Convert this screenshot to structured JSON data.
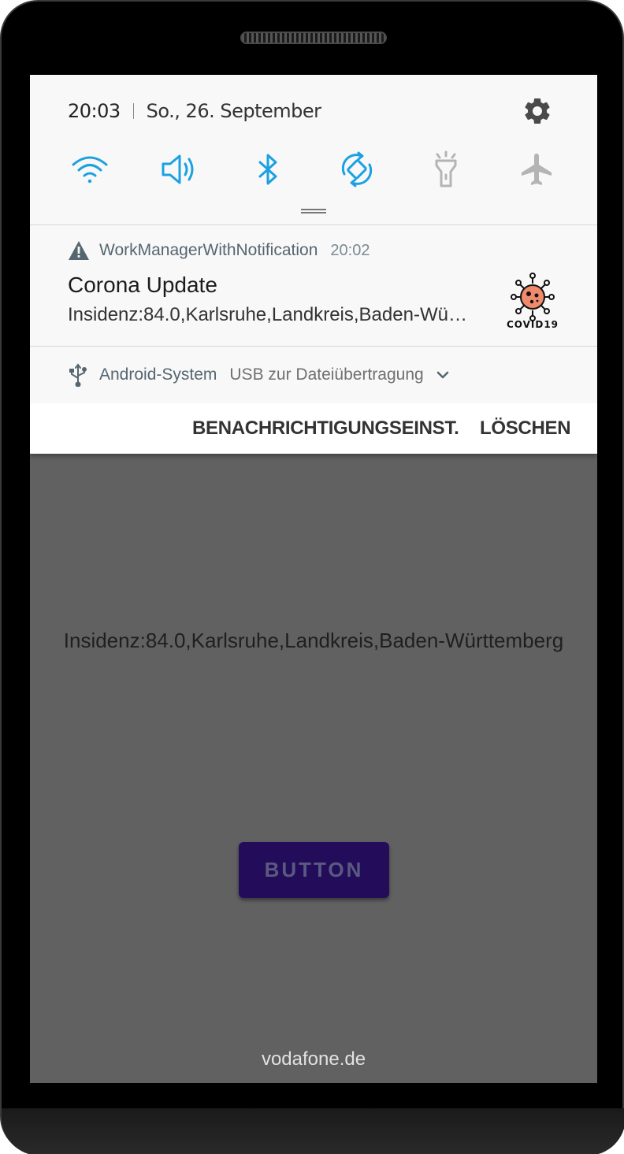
{
  "status": {
    "time": "20:03",
    "date": "So., 26. September"
  },
  "quick_settings": [
    {
      "icon": "wifi-icon",
      "active": true
    },
    {
      "icon": "sound-icon",
      "active": true
    },
    {
      "icon": "bluetooth-icon",
      "active": true
    },
    {
      "icon": "auto-rotate-icon",
      "active": true
    },
    {
      "icon": "flashlight-icon",
      "active": false
    },
    {
      "icon": "airplane-mode-icon",
      "active": false
    }
  ],
  "notification": {
    "app_name": "WorkManagerWithNotification",
    "time": "20:02",
    "title": "Corona Update",
    "text": "Insidenz:84.0,Karlsruhe,Landkreis,Baden-Württemberg",
    "icon_label": "COVID19"
  },
  "system_notification": {
    "app_name": "Android-System",
    "text": "USB zur Dateiübertragung"
  },
  "actions": {
    "settings_label": "BENACHRICHTIGUNGSEINST.",
    "clear_label": "LÖSCHEN"
  },
  "app": {
    "info_text": "Insidenz:84.0,Karlsruhe,Landkreis,Baden-Württemberg",
    "button_label": "BUTTON"
  },
  "carrier": "vodafone.de",
  "colors": {
    "active_icon": "#1ba1e2",
    "inactive_icon": "#b4b4b4",
    "button": "#230c5a",
    "screen_dim": "#616161"
  }
}
